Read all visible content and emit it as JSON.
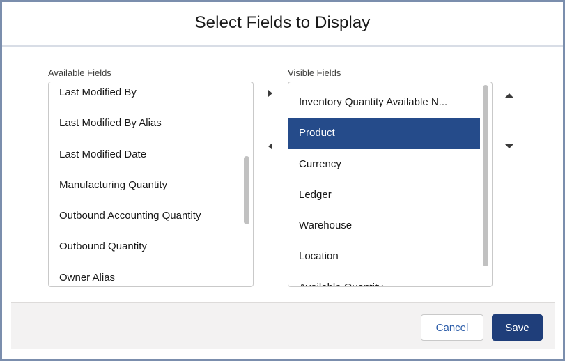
{
  "modal": {
    "title": "Select Fields to Display"
  },
  "available": {
    "label": "Available Fields",
    "items": [
      "Last Modified By",
      "Last Modified By Alias",
      "Last Modified Date",
      "Manufacturing Quantity",
      "Outbound Accounting Quantity",
      "Outbound Quantity",
      "Owner Alias"
    ]
  },
  "visible": {
    "label": "Visible Fields",
    "items": [
      "Inventory Quantity Available N...",
      "Product",
      "Currency",
      "Ledger",
      "Warehouse",
      "Location",
      "Available Quantity"
    ],
    "selected": "Product"
  },
  "controls": {
    "move_right_icon": "right-arrow-icon",
    "move_left_icon": "left-arrow-icon",
    "move_up_icon": "up-arrow-icon",
    "move_down_icon": "down-arrow-icon"
  },
  "footer": {
    "cancel_label": "Cancel",
    "save_label": "Save"
  },
  "colors": {
    "frame_border": "#7b8ead",
    "selected_row": "#254b8a",
    "save_button": "#1f3e7a",
    "cancel_text": "#2a5ba8",
    "footer_bg": "#f3f2f2"
  }
}
